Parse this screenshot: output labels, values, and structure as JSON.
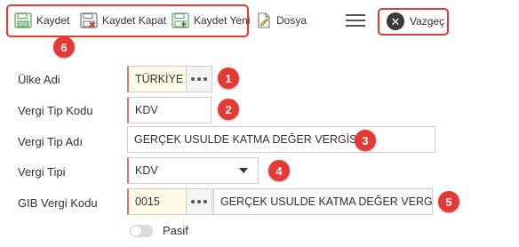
{
  "toolbar": {
    "save_label": "Kaydet",
    "save_close_label": "Kaydet Kapat",
    "save_new_label": "Kaydet Yeni",
    "file_label": "Dosya",
    "cancel_label": "Vazgeç"
  },
  "form": {
    "country_label": "Ülke Adi",
    "country_value": "TÜRKİYE",
    "tax_type_code_label": "Vergi Tip Kodu",
    "tax_type_code_value": "KDV",
    "tax_type_name_label": "Vergi Tip Adı",
    "tax_type_name_value": "GERÇEK USULDE KATMA DEĞER VERGİSİ",
    "tax_type_label": "Vergi Tipi",
    "tax_type_value": "KDV",
    "gib_code_label": "GIB Vergi Kodu",
    "gib_code_value": "0015",
    "gib_code_desc": "GERÇEK USULDE KATMA DEĞER VERGİSİ",
    "passive_label": "Pasif",
    "passive_on": false
  },
  "annotations": {
    "b1": "1",
    "b2": "2",
    "b3": "3",
    "b4": "4",
    "b5": "5",
    "b6": "6"
  },
  "colors": {
    "annotation_red": "#e53935",
    "required_marker": "#e57373",
    "lookup_field_bg": "#fffbe6"
  }
}
